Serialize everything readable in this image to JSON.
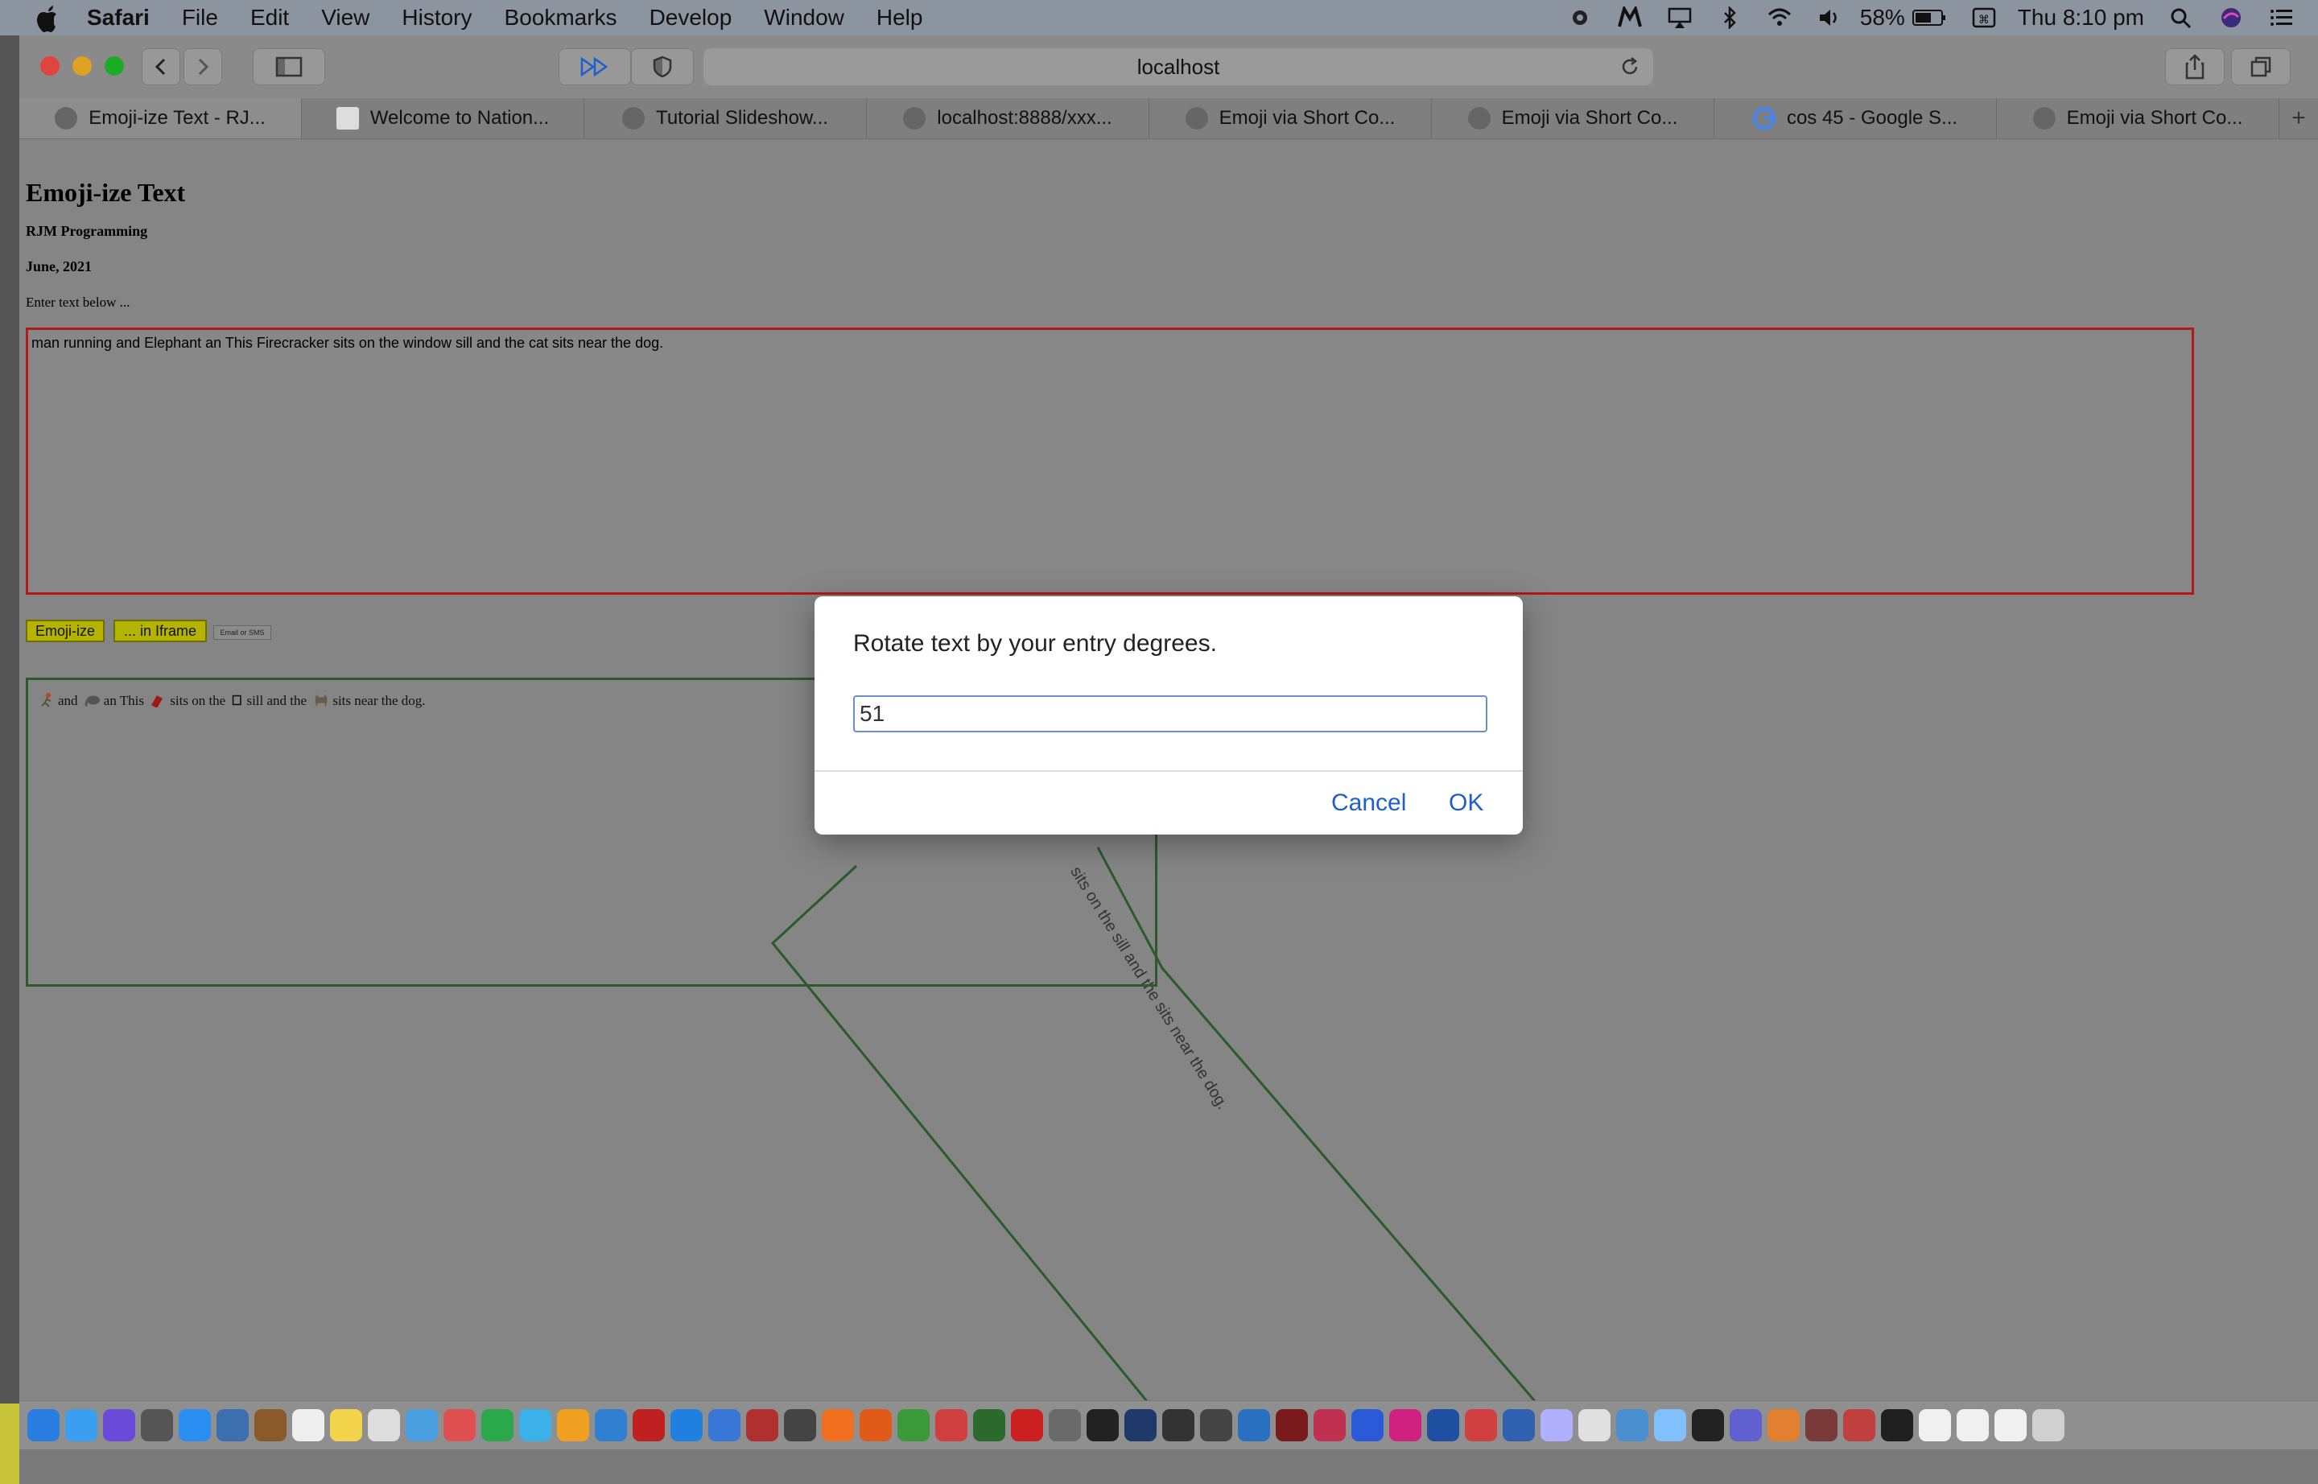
{
  "menubar": {
    "app_name": "Safari",
    "menus": [
      "File",
      "Edit",
      "View",
      "History",
      "Bookmarks",
      "Develop",
      "Window",
      "Help"
    ],
    "battery": "58%",
    "clock": "Thu 8:10 pm"
  },
  "browser": {
    "url": "localhost",
    "tabs": [
      "Emoji-ize Text - RJ...",
      "Welcome to Nation...",
      "Tutorial Slideshow...",
      "localhost:8888/xxx...",
      "Emoji via Short Co...",
      "Emoji via Short Co...",
      "cos 45 - Google S...",
      "Emoji via Short Co..."
    ],
    "new_tab_glyph": "+"
  },
  "page": {
    "title": "Emoji-ize Text",
    "author": "RJM Programming",
    "date": "June, 2021",
    "prompt": "Enter text below ...",
    "input_text": "man running and Elephant an This Firecracker sits on the window sill  and the cat sits near the dog.",
    "buttons": {
      "emojize": "Emoji-ize",
      "iframe": "... in Iframe",
      "email": "Email or SMS"
    },
    "output_parts": [
      "and",
      "an This",
      "sits on the",
      "sill and the",
      "sits near the dog."
    ],
    "rotated_text": "sits on the  sill  and the  sits near the dog.",
    "colors": {
      "input_border": "#b01a1a",
      "output_border": "#2c5a2c",
      "button_bg": "#b3b300"
    }
  },
  "dialog": {
    "message": "Rotate text by your entry degrees.",
    "input_value": "51",
    "cancel_label": "Cancel",
    "ok_label": "OK",
    "accent": "#1d5fd1"
  }
}
